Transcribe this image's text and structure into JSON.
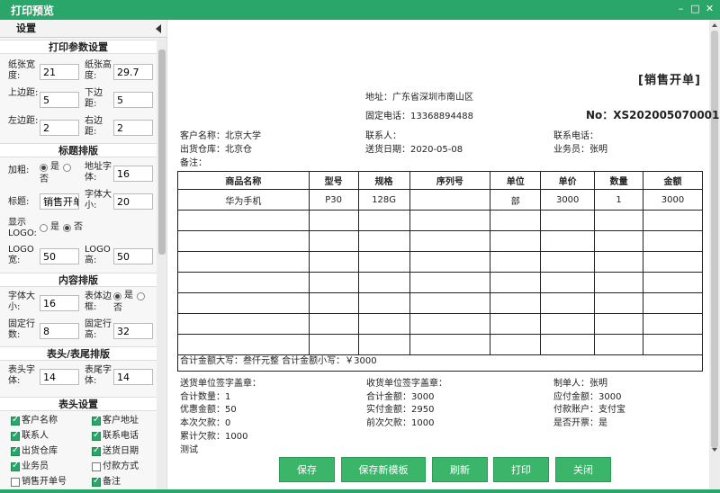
{
  "window": {
    "title": "打印预览"
  },
  "sidebar": {
    "header": "设置",
    "print_params": {
      "title": "打印参数设置",
      "paper_width_label": "纸张宽度:",
      "paper_width": "21",
      "paper_height_label": "纸张高度:",
      "paper_height": "29.7",
      "top_margin_label": "上边距:",
      "top_margin": "5",
      "bottom_margin_label": "下边距:",
      "bottom_margin": "5",
      "left_margin_label": "左边距:",
      "left_margin": "2",
      "right_margin_label": "右边距:",
      "right_margin": "2"
    },
    "title_layout": {
      "title": "标题排版",
      "bold_label": "加粗:",
      "yes": "是",
      "no": "否",
      "address_font_label": "地址字体:",
      "address_font": "16",
      "title_label": "标题:",
      "title_value": "销售开单",
      "title_font_label": "字体大小:",
      "title_font": "20",
      "show_logo_label": "显示LOGO:",
      "logo_width_label": "LOGO宽:",
      "logo_width": "50",
      "logo_height_label": "LOGO高:",
      "logo_height": "50"
    },
    "content_layout": {
      "title": "内容排版",
      "font_size_label": "字体大小:",
      "font_size": "16",
      "table_border_label": "表体边框:",
      "fixed_rows_label": "固定行数:",
      "fixed_rows": "8",
      "fixed_row_height_label": "固定行高:",
      "fixed_row_height": "32"
    },
    "header_footer_layout": {
      "title": "表头/表尾排版",
      "header_font_label": "表头字体:",
      "header_font": "14",
      "footer_font_label": "表尾字体:",
      "footer_font": "14"
    },
    "header_settings": {
      "title": "表头设置",
      "fields": [
        {
          "label": "客户名称",
          "checked": true
        },
        {
          "label": "客户地址",
          "checked": true
        },
        {
          "label": "联系人",
          "checked": true
        },
        {
          "label": "联系电话",
          "checked": true
        },
        {
          "label": "出货仓库",
          "checked": true
        },
        {
          "label": "送货日期",
          "checked": true
        },
        {
          "label": "业务员",
          "checked": true
        },
        {
          "label": "付款方式",
          "checked": false
        },
        {
          "label": "销售开单号",
          "checked": false
        },
        {
          "label": "备注",
          "checked": true
        }
      ]
    }
  },
  "document": {
    "title": "[销售开单]",
    "address": "地址：广东省深圳市南山区",
    "phone": "固定电话：13368894488",
    "order_no": "No：XS202005070001",
    "customer": "客户名称：北京大学",
    "contact": "联系人：",
    "contact_phone": "联系电话：",
    "warehouse": "出货仓库：北京仓",
    "delivery_date": "送货日期：2020-05-08",
    "salesman": "业务员：张明",
    "remark": "备注：",
    "table": {
      "headers": [
        "商品名称",
        "型号",
        "规格",
        "序列号",
        "单位",
        "单价",
        "数量",
        "金额"
      ],
      "rows": [
        [
          "华为手机",
          "P30",
          "128G",
          "",
          "部",
          "3000",
          "1",
          "3000"
        ]
      ]
    },
    "total_line": "合计金额大写：叁仟元整 合计金额小写：￥3000",
    "footer": {
      "deliver_sign": "送货单位签字盖章：",
      "receive_sign": "收货单位签字盖章：",
      "maker": "制单人：张明",
      "total_qty": "合计数量：1",
      "total_amount": "合计金额：3000",
      "payable": "应付金额：3000",
      "discount": "优惠金额：50",
      "paid": "实付金额：2950",
      "pay_account": "付款账户：支付宝",
      "current_debt": "本次欠款：0",
      "prev_debt": "前次欠款：1000",
      "invoiced": "是否开票：是",
      "cumulative_debt": "累计欠款：1000",
      "note": "测试"
    }
  },
  "buttons": {
    "save": "保存",
    "save_template": "保存新模板",
    "refresh": "刷新",
    "print": "打印",
    "close": "关闭"
  },
  "colors": {
    "accent": "#2aa66a",
    "button": "#3bb56a"
  }
}
